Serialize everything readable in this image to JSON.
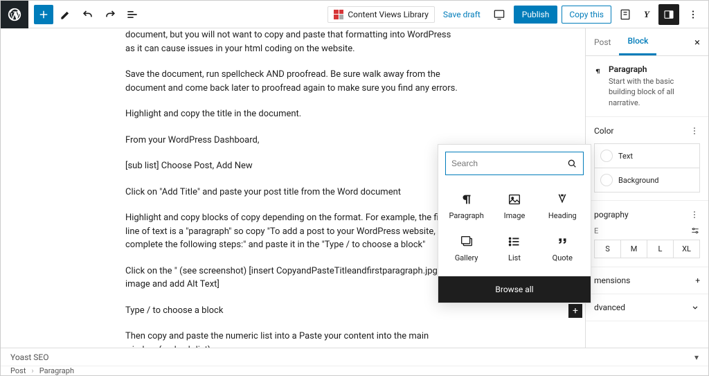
{
  "toolbar": {
    "content_views_label": "Content Views Library",
    "save_draft": "Save draft",
    "publish": "Publish",
    "copy_this": "Copy this"
  },
  "editor": {
    "paragraphs": [
      "document, but you will not want to copy and paste that formatting into WordPress as it can cause issues in your html coding on the website.",
      "Save the document, run spellcheck AND proofread. Be sure walk away from the document and come back later to proofread again to make sure you find any errors.",
      "Highlight and copy the title in the document.",
      "From your WordPress Dashboard,",
      "[sub list] Choose Post, Add New",
      "Click on \"Add Title\" and paste your post title from the Word document",
      "Highlight and copy blocks of copy depending on the format. For example, the first line of text is a \"paragraph\" so copy \"To add a post to your WordPress website, complete the following steps:\" and paste it in the \"Type / to choose a block\"",
      "Click on the \" (see screenshot) [insert CopyandPasteTitleandfirstparagraph.jpg image and add Alt Text]",
      "Type / to choose a block",
      "Then copy and paste the numeric list into a Paste your content into the main window {end sub-list}"
    ]
  },
  "inserter": {
    "search_placeholder": "Search",
    "blocks": [
      {
        "label": "Paragraph"
      },
      {
        "label": "Image"
      },
      {
        "label": "Heading"
      },
      {
        "label": "Gallery"
      },
      {
        "label": "List"
      },
      {
        "label": "Quote"
      }
    ],
    "browse_all": "Browse all"
  },
  "sidebar": {
    "tabs": {
      "post": "Post",
      "block": "Block"
    },
    "block_name": "Paragraph",
    "block_desc": "Start with the basic building block of all narrative.",
    "panels": {
      "color": {
        "title": "Color",
        "text": "Text",
        "background": "Background"
      },
      "typography": {
        "title": "pography",
        "size_label": "E",
        "sizes": [
          "S",
          "M",
          "L",
          "XL"
        ]
      },
      "dimensions": {
        "title": "mensions"
      },
      "advanced": {
        "title": "dvanced"
      }
    }
  },
  "footer": {
    "yoast": "Yoast SEO",
    "crumb_post": "Post",
    "crumb_block": "Paragraph"
  }
}
